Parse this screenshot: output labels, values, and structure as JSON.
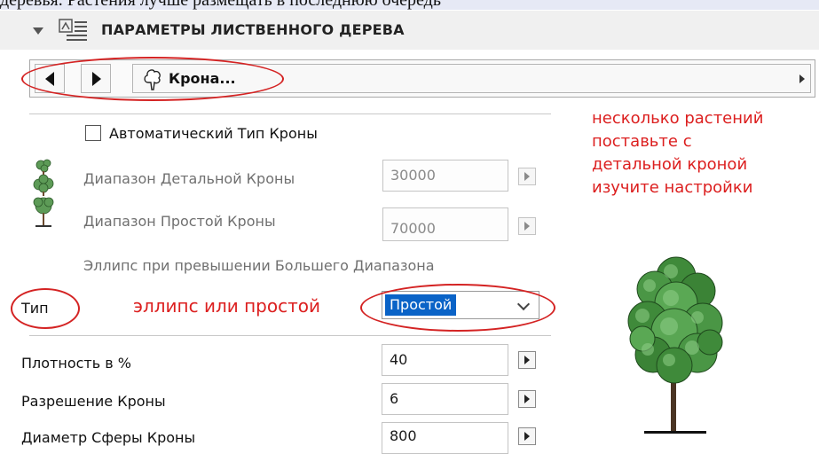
{
  "top_text": "деревья. Растения лучше размещать в последнюю очередь",
  "header": {
    "title": "ПАРАМЕТРЫ ЛИСТВЕННОГО ДЕРЕВА",
    "collapse_icon": "triangle-down-icon",
    "panel_icon": "tree-parameters-icon"
  },
  "nav": {
    "prev_icon": "triangle-left-icon",
    "next_icon": "triangle-right-icon",
    "section_icon": "tree-crown-outline-icon",
    "section_label": "Крона...",
    "menu_icon": "chevron-right-icon"
  },
  "auto_crown": {
    "label": "Автоматический Тип Кроны",
    "checked": false
  },
  "ranges": {
    "detail_label": "Диапазон Детальной Кроны",
    "detail_value": "30000",
    "simple_label": "Диапазон Простой Кроны",
    "simple_value": "70000",
    "ellipse_note": "Эллипс при превышении Большего Диапазона"
  },
  "type_row": {
    "label": "Тип",
    "selected": "Простой"
  },
  "params": [
    {
      "label": "Плотность в %",
      "value": "40"
    },
    {
      "label": "Разрешение Кроны",
      "value": "6"
    },
    {
      "label": "Диаметр Сферы Кроны",
      "value": "800"
    }
  ],
  "annotations": {
    "note_line1": "несколько растений",
    "note_line2": "поставьте с",
    "note_line3": "детальной кроной",
    "note_line4": "изучите настройки",
    "type_hint": "эллипс или простой"
  },
  "colors": {
    "annotation_red": "#dc1f1f",
    "selection_blue": "#0a63c7",
    "header_bg": "#f0f0f0"
  }
}
